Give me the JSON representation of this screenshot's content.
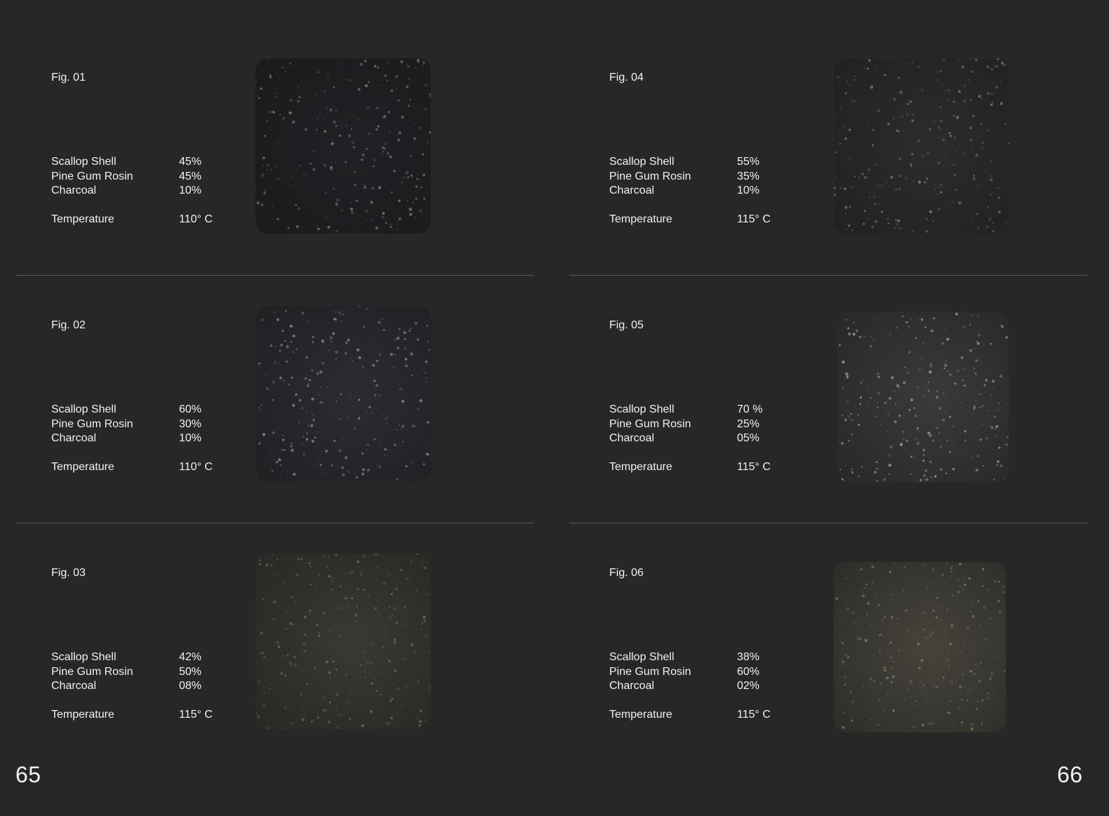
{
  "pages": [
    {
      "page_number": "65",
      "samples": [
        {
          "fig": "Fig. 01",
          "rows": [
            {
              "label": "Scallop Shell",
              "value": "45%"
            },
            {
              "label": "Pine Gum Rosin",
              "value": "45%"
            },
            {
              "label": "Charcoal",
              "value": "10%"
            }
          ],
          "temperature_label": "Temperature",
          "temperature_value": "110° C",
          "color": "#1f2124",
          "speck": "#8a8d90"
        },
        {
          "fig": "Fig. 02",
          "rows": [
            {
              "label": "Scallop Shell",
              "value": "60%"
            },
            {
              "label": "Pine Gum Rosin",
              "value": "30%"
            },
            {
              "label": "Charcoal",
              "value": "10%"
            }
          ],
          "temperature_label": "Temperature",
          "temperature_value": "110° C",
          "color": "#2a2c30",
          "speck": "#9a9ca0"
        },
        {
          "fig": "Fig. 03",
          "rows": [
            {
              "label": "Scallop Shell",
              "value": "42%"
            },
            {
              "label": "Pine Gum Rosin",
              "value": "50%"
            },
            {
              "label": "Charcoal",
              "value": "08%"
            }
          ],
          "temperature_label": "Temperature",
          "temperature_value": "115° C",
          "color": "#3a3a33",
          "speck": "#7a7868"
        }
      ]
    },
    {
      "page_number": "66",
      "samples": [
        {
          "fig": "Fig. 04",
          "rows": [
            {
              "label": "Scallop Shell",
              "value": "55%"
            },
            {
              "label": "Pine Gum Rosin",
              "value": "35%"
            },
            {
              "label": "Charcoal",
              "value": "10%"
            }
          ],
          "temperature_label": "Temperature",
          "temperature_value": "115° C",
          "color": "#2b2d2b",
          "speck": "#8c8e8a"
        },
        {
          "fig": "Fig. 05",
          "rows": [
            {
              "label": "Scallop Shell",
              "value": "70 %"
            },
            {
              "label": "Pine Gum Rosin",
              "value": "25%"
            },
            {
              "label": "Charcoal",
              "value": "05%"
            }
          ],
          "temperature_label": "Temperature",
          "temperature_value": "115° C",
          "color": "#3a3a38",
          "speck": "#b4b4b0"
        },
        {
          "fig": "Fig. 06",
          "rows": [
            {
              "label": "Scallop Shell",
              "value": "38%"
            },
            {
              "label": "Pine Gum Rosin",
              "value": "60%"
            },
            {
              "label": "Charcoal",
              "value": "02%"
            }
          ],
          "temperature_label": "Temperature",
          "temperature_value": "115° C",
          "color": "#45433b",
          "speck": "#8a8778"
        }
      ]
    }
  ]
}
